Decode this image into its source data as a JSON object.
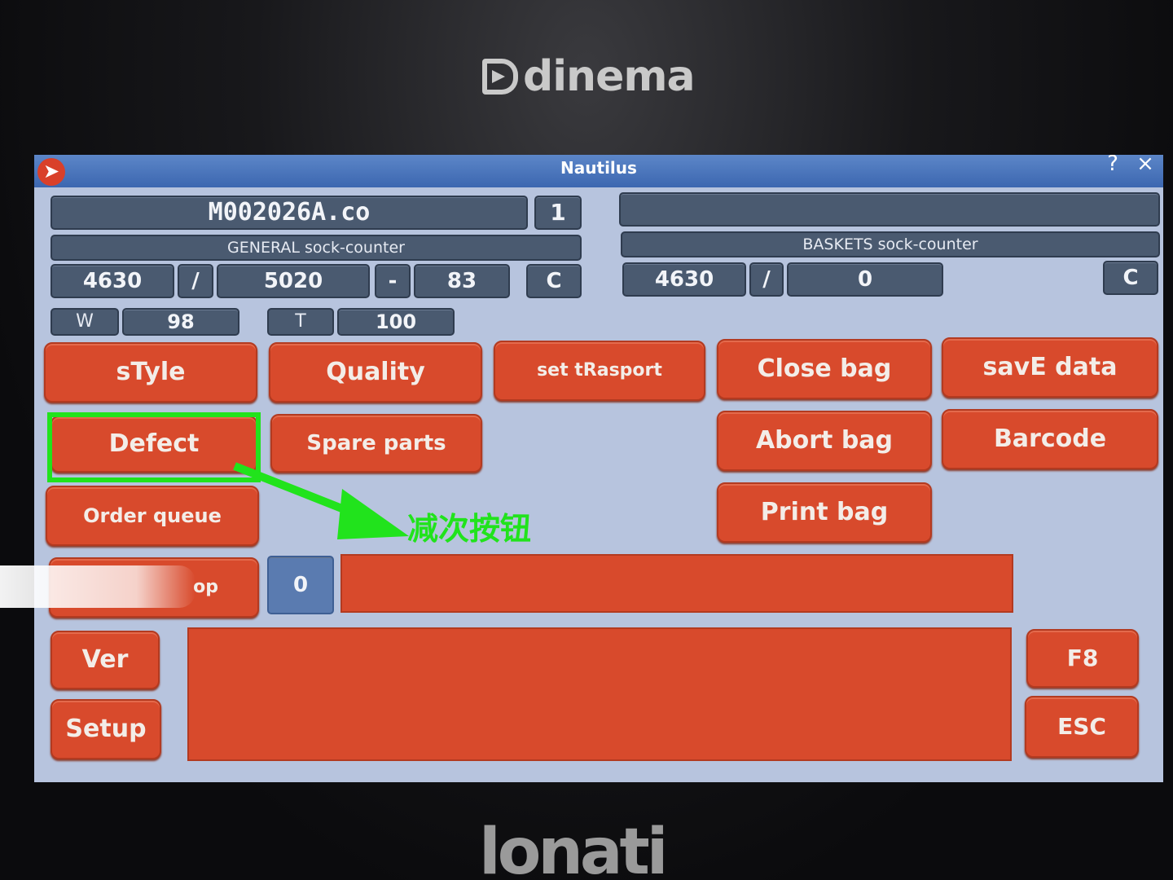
{
  "brand": {
    "top": "dinema",
    "bottom": "lonati"
  },
  "window": {
    "title": "Nautilus",
    "help": "?",
    "close": "×"
  },
  "file": {
    "name": "M002026A.co",
    "index": "1",
    "right_field": ""
  },
  "general": {
    "label": "GENERAL sock-counter",
    "count": "4630",
    "sep1": "/",
    "total": "5020",
    "sep2": "-",
    "diff": "83",
    "clear": "C"
  },
  "baskets": {
    "label": "BASKETS sock-counter",
    "count": "4630",
    "sep": "/",
    "total": "0",
    "clear": "C"
  },
  "wt": {
    "w_label": "W",
    "w_value": "98",
    "t_label": "T",
    "t_value": "100"
  },
  "buttons": {
    "style": "sTyle",
    "quality": "Quality",
    "set_transport": "set tRasport",
    "close_bag": "Close bag",
    "save_data": "savE data",
    "defect": "Defect",
    "spare_parts": "Spare parts",
    "abort_bag": "Abort bag",
    "barcode": "Barcode",
    "order_queue": "Order queue",
    "print_bag": "Print bag",
    "stop_partial": "op",
    "stop_count": "0",
    "ver": "Ver",
    "setup": "Setup",
    "f8": "F8",
    "esc": "ESC"
  },
  "annotation": {
    "text": "减次按钮"
  },
  "colors": {
    "button": "#d84a2c",
    "screen": "#b7c4de",
    "field": "#4a5a70",
    "highlight": "#21e31c"
  }
}
